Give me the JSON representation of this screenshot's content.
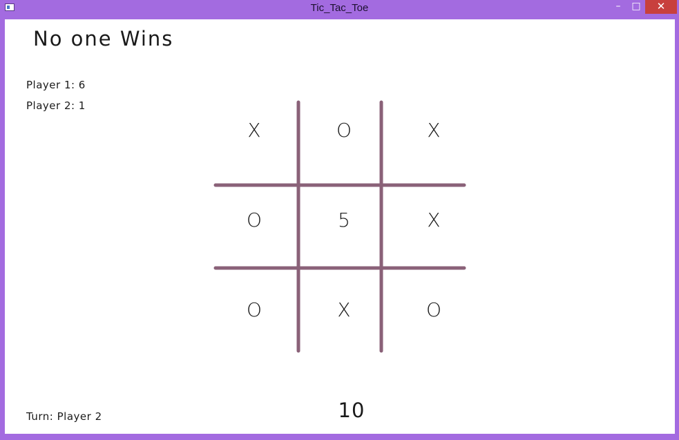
{
  "window": {
    "title": "Tic_Tac_Toe",
    "controls": {
      "minimize": "–",
      "maximize": "□",
      "close": "✕"
    }
  },
  "game": {
    "status": "No one Wins",
    "scores": {
      "player1": "Player 1: 6",
      "player2": "Player 2: 1"
    },
    "turn": "Turn: Player 2",
    "timer": "10",
    "board": [
      [
        "X",
        "O",
        "X"
      ],
      [
        "O",
        "5",
        "X"
      ],
      [
        "O",
        "X",
        "O"
      ]
    ]
  },
  "colors": {
    "window_frame": "#a36be0",
    "grid_lines": "#8a6178",
    "close_button": "#c8403d"
  }
}
